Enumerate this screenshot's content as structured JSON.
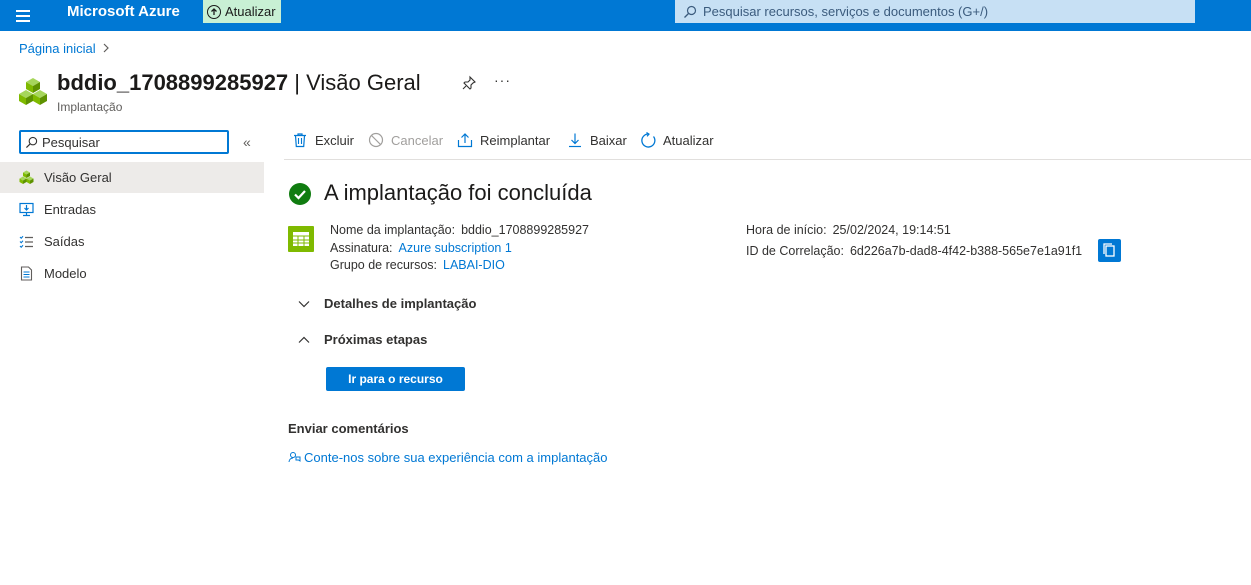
{
  "header": {
    "brand": "Microsoft Azure",
    "update_label": "Atualizar",
    "search_placeholder": "Pesquisar recursos, serviços e documentos (G+/)"
  },
  "breadcrumb": {
    "home": "Página inicial"
  },
  "resource": {
    "name": "bddio_1708899285927",
    "separator": " | ",
    "page": "Visão Geral",
    "type": "Implantação"
  },
  "sidebar": {
    "search_placeholder": "Pesquisar",
    "items": [
      {
        "label": "Visão Geral",
        "icon": "overview-icon",
        "active": true
      },
      {
        "label": "Entradas",
        "icon": "inputs-icon"
      },
      {
        "label": "Saídas",
        "icon": "outputs-icon"
      },
      {
        "label": "Modelo",
        "icon": "template-icon"
      }
    ]
  },
  "toolbar": {
    "delete": "Excluir",
    "cancel": "Cancelar",
    "redeploy": "Reimplantar",
    "download": "Baixar",
    "refresh": "Atualizar"
  },
  "status": {
    "title": "A implantação foi concluída"
  },
  "details": {
    "deployment_name_label": "Nome da implantação:",
    "deployment_name_value": "bddio_1708899285927",
    "subscription_label": "Assinatura:",
    "subscription_value": "Azure subscription 1",
    "resource_group_label": "Grupo de recursos:",
    "resource_group_value": "LABAI-DIO",
    "start_time_label": "Hora de início:",
    "start_time_value": "25/02/2024, 19:14:51",
    "correlation_label": "ID de Correlação:",
    "correlation_value": "6d226a7b-dad8-4f42-b388-565e7e1a91f1"
  },
  "sections": {
    "deployment_details": "Detalhes de implantação",
    "next_steps": "Próximas etapas",
    "go_to_resource": "Ir para o recurso"
  },
  "feedback": {
    "title": "Enviar comentários",
    "link": "Conte-nos sobre sua experiência com a implantação"
  },
  "colors": {
    "brand": "#0078d4",
    "success": "#107c10",
    "update_bg": "#c8f0d4",
    "search_bg": "#c7e0f4"
  }
}
